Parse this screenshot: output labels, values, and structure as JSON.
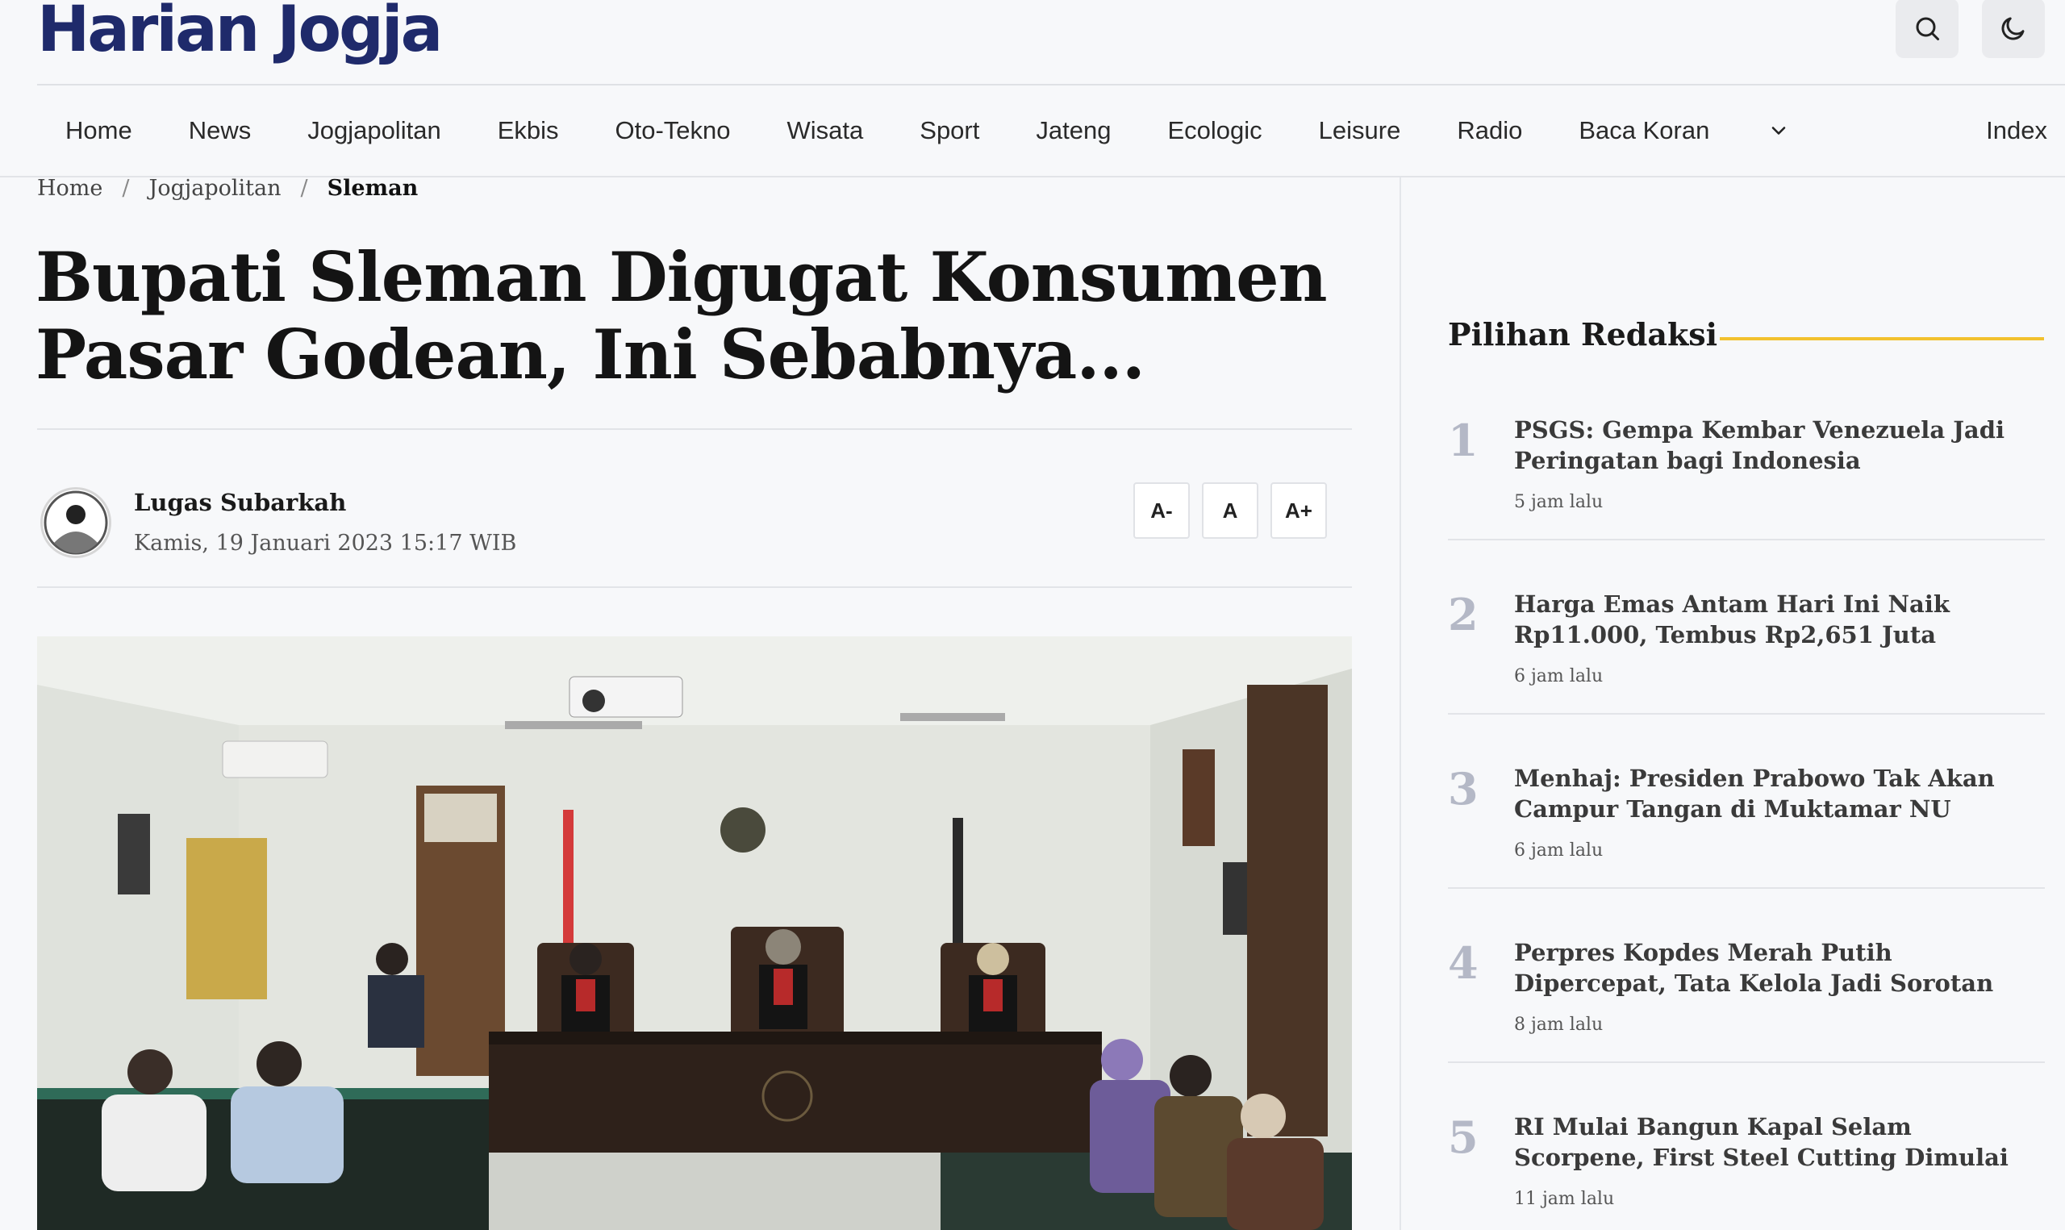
{
  "site": {
    "logo_text": "Harian Jogja",
    "brand_color": "#1f2a6b",
    "accent_color": "#f2b81a",
    "search_icon": "search-icon",
    "theme_icon": "moon-icon"
  },
  "nav": {
    "items": [
      "Home",
      "News",
      "Jogjapolitan",
      "Ekbis",
      "Oto-Tekno",
      "Wisata",
      "Sport",
      "Jateng",
      "Ecologic",
      "Leisure",
      "Radio",
      "Baca Koran"
    ],
    "more_icon": "chevron-down-icon",
    "index_label": "Index"
  },
  "breadcrumb": {
    "items": [
      "Home",
      "Jogjapolitan",
      "Sleman"
    ],
    "separator": "/"
  },
  "article": {
    "title": "Bupati Sleman Digugat Konsumen Pasar Godean, Ini Sebabnya...",
    "author": "Lugas Subarkah",
    "date": "Kamis, 19 Januari 2023 15:17 WIB",
    "font_controls": [
      "A-",
      "A",
      "A+"
    ]
  },
  "sidebar": {
    "title": "Pilihan Redaksi",
    "items": [
      {
        "num": "1",
        "headline": "PSGS: Gempa Kembar Venezuela Jadi Peringatan bagi Indonesia",
        "time": "5 jam lalu"
      },
      {
        "num": "2",
        "headline": "Harga Emas Antam Hari Ini Naik Rp11.000, Tembus Rp2,651 Juta",
        "time": "6 jam lalu"
      },
      {
        "num": "3",
        "headline": "Menhaj: Presiden Prabowo Tak Akan Campur Tangan di Muktamar NU",
        "time": "6 jam lalu"
      },
      {
        "num": "4",
        "headline": "Perpres Kopdes Merah Putih Dipercepat, Tata Kelola Jadi Sorotan",
        "time": "8 jam lalu"
      },
      {
        "num": "5",
        "headline": "RI Mulai Bangun Kapal Selam Scorpene, First Steel Cutting Dimulai",
        "time": "11 jam lalu"
      }
    ]
  }
}
